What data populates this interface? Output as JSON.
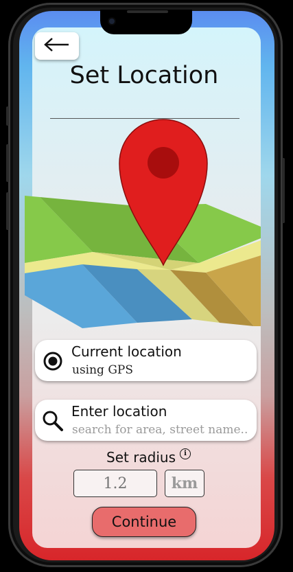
{
  "header": {
    "back_icon": "arrow-left-icon",
    "title": "Set Location"
  },
  "illustration": {
    "map_icon": "folded-map-icon",
    "pin_icon": "map-pin-icon",
    "colors": {
      "pin": "#e01e1e",
      "pin_dot": "#a80d0d",
      "grass": "#86c94a",
      "road": "#ece98e",
      "water": "#5aa6d9",
      "sand": "#c9a54a"
    }
  },
  "options": [
    {
      "icon": "radio-selected-icon",
      "label": "Current location",
      "sublabel": "using GPS"
    },
    {
      "icon": "search-icon",
      "label": "Enter location",
      "placeholder": "search for area, street name.."
    }
  ],
  "radius": {
    "label": "Set radius",
    "info_icon": "info-icon",
    "info_glyph": "i",
    "placeholder": "1.2",
    "unit": "km"
  },
  "actions": {
    "continue_label": "Continue",
    "button_color": "#e86c6c"
  }
}
